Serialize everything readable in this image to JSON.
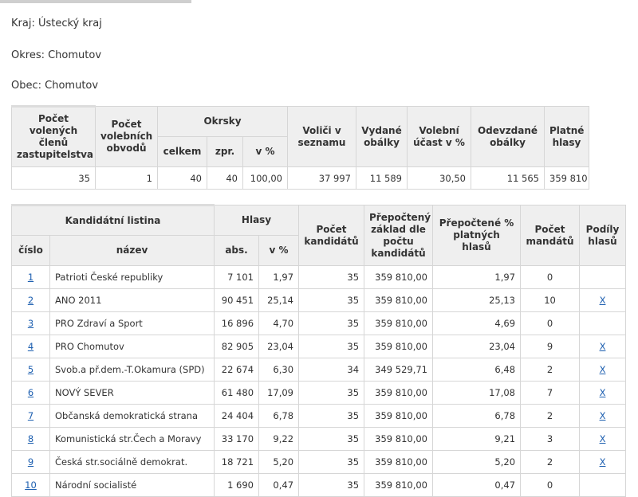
{
  "region": {
    "kraj": "Kraj: Ústecký kraj",
    "okres": "Okres: Chomutov",
    "obec": "Obec: Chomutov"
  },
  "summary": {
    "headers": {
      "members": "Počet volených členů zastupitelstva",
      "districts": "Počet volebních obvodů",
      "okrsky": "Okrsky",
      "okrsky_total": "celkem",
      "okrsky_processed": "zpr.",
      "okrsky_pct": "v %",
      "voters": "Voliči v seznamu",
      "envelopes_issued": "Vydané obálky",
      "turnout": "Volební účast v %",
      "envelopes_returned": "Odevzdané obálky",
      "valid_votes": "Platné hlasy"
    },
    "values": {
      "members": "35",
      "districts": "1",
      "okrsky_total": "40",
      "okrsky_processed": "40",
      "okrsky_pct": "100,00",
      "voters": "37 997",
      "envelopes_issued": "11 589",
      "turnout": "30,50",
      "envelopes_returned": "11 565",
      "valid_votes": "359 810"
    }
  },
  "results": {
    "headers": {
      "list": "Kandidátní listina",
      "number": "číslo",
      "name": "název",
      "votes": "Hlasy",
      "abs": "abs.",
      "pct": "v %",
      "candidates": "Počet kandidátů",
      "recalc_base": "Přepočtený základ dle počtu kandidátů",
      "recalc_pct": "Přepočtené % platných hlasů",
      "mandates": "Počet mandátů",
      "shares": "Podíly hlasů"
    },
    "rows": [
      {
        "num": "1",
        "name": "Patrioti České republiky",
        "abs": "7 101",
        "pct": "1,97",
        "candidates": "35",
        "base": "359 810,00",
        "rpct": "1,97",
        "mandates": "0",
        "share": ""
      },
      {
        "num": "2",
        "name": "ANO 2011",
        "abs": "90 451",
        "pct": "25,14",
        "candidates": "35",
        "base": "359 810,00",
        "rpct": "25,13",
        "mandates": "10",
        "share": "X"
      },
      {
        "num": "3",
        "name": "PRO Zdraví a Sport",
        "abs": "16 896",
        "pct": "4,70",
        "candidates": "35",
        "base": "359 810,00",
        "rpct": "4,69",
        "mandates": "0",
        "share": ""
      },
      {
        "num": "4",
        "name": "PRO Chomutov",
        "abs": "82 905",
        "pct": "23,04",
        "candidates": "35",
        "base": "359 810,00",
        "rpct": "23,04",
        "mandates": "9",
        "share": "X"
      },
      {
        "num": "5",
        "name": "Svob.a př.dem.-T.Okamura (SPD)",
        "abs": "22 674",
        "pct": "6,30",
        "candidates": "34",
        "base": "349 529,71",
        "rpct": "6,48",
        "mandates": "2",
        "share": "X"
      },
      {
        "num": "6",
        "name": "NOVÝ SEVER",
        "abs": "61 480",
        "pct": "17,09",
        "candidates": "35",
        "base": "359 810,00",
        "rpct": "17,08",
        "mandates": "7",
        "share": "X"
      },
      {
        "num": "7",
        "name": "Občanská demokratická strana",
        "abs": "24 404",
        "pct": "6,78",
        "candidates": "35",
        "base": "359 810,00",
        "rpct": "6,78",
        "mandates": "2",
        "share": "X"
      },
      {
        "num": "8",
        "name": "Komunistická str.Čech a Moravy",
        "abs": "33 170",
        "pct": "9,22",
        "candidates": "35",
        "base": "359 810,00",
        "rpct": "9,21",
        "mandates": "3",
        "share": "X"
      },
      {
        "num": "9",
        "name": "Česká str.sociálně demokrat.",
        "abs": "18 721",
        "pct": "5,20",
        "candidates": "35",
        "base": "359 810,00",
        "rpct": "5,20",
        "mandates": "2",
        "share": "X"
      },
      {
        "num": "10",
        "name": "Národní socialisté",
        "abs": "1 690",
        "pct": "0,47",
        "candidates": "35",
        "base": "359 810,00",
        "rpct": "0,47",
        "mandates": "0",
        "share": ""
      }
    ]
  }
}
